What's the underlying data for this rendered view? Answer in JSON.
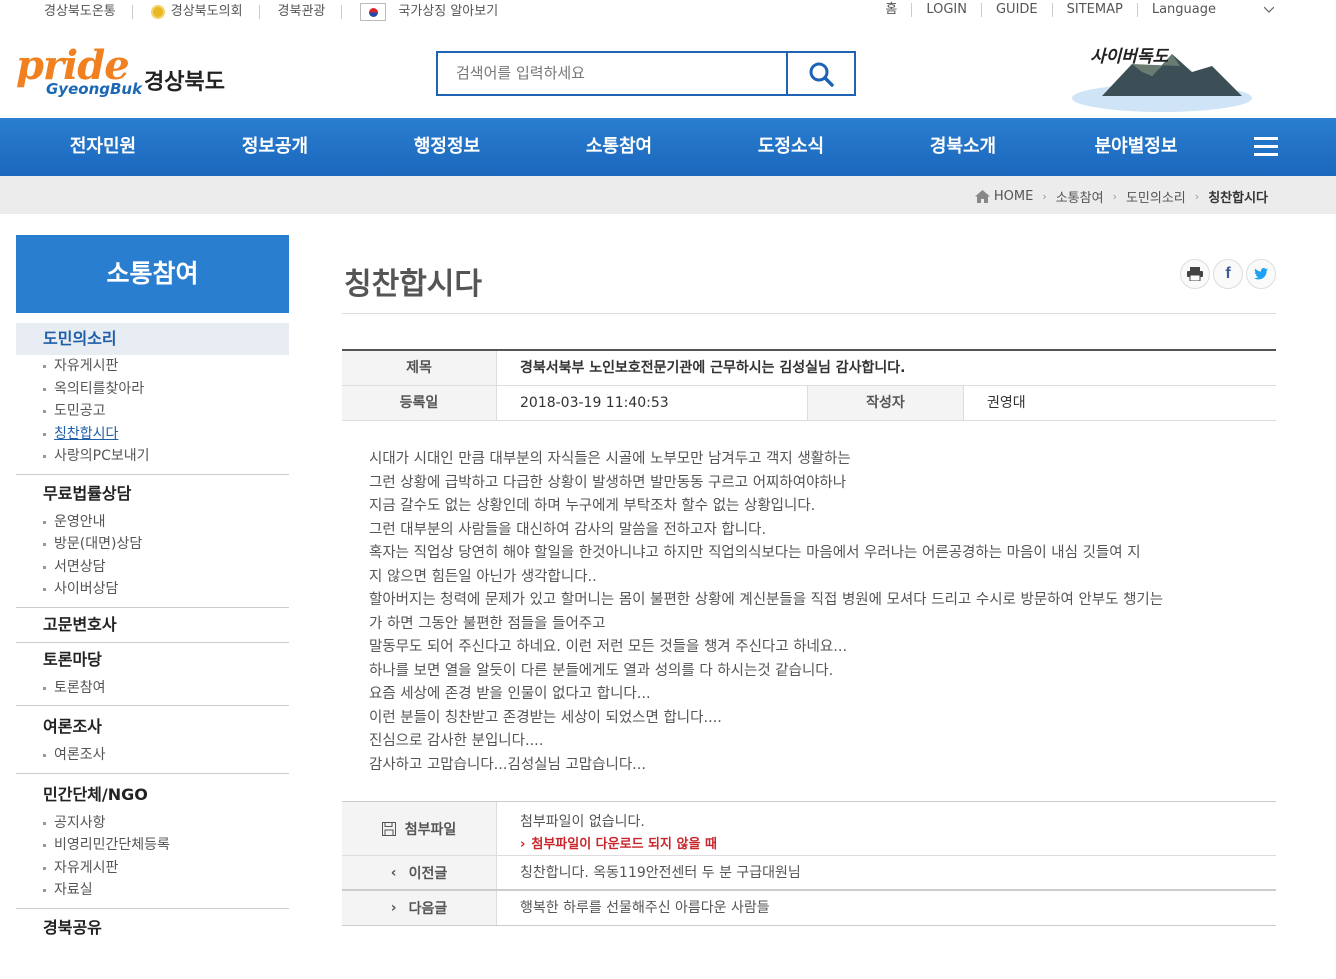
{
  "topbar": {
    "links": [
      "경상북도온통",
      "경상북도의회",
      "경북관광",
      "국가상징 알아보기"
    ],
    "right_links": [
      "홈",
      "LOGIN",
      "GUIDE",
      "SITEMAP",
      "Language"
    ]
  },
  "header": {
    "logo_main": "pride",
    "logo_sub": "GyeongBuk",
    "logo_name": "경상북도",
    "search_placeholder": "검색어를 입력하세요",
    "dokdo_label": "사이버독도"
  },
  "nav": {
    "items": [
      "전자민원",
      "정보공개",
      "행정정보",
      "소통참여",
      "도정소식",
      "경북소개",
      "분야별정보"
    ]
  },
  "breadcrumb": [
    "HOME",
    "소통참여",
    "도민의소리",
    "칭찬합시다"
  ],
  "sidebar": {
    "title": "소통참여",
    "groups": [
      {
        "head": "도민의소리",
        "items": [
          "자유게시판",
          "옥의티를찾아라",
          "도민공고",
          "칭찬합시다",
          "사랑의PC보내기"
        ]
      },
      {
        "head": "무료법률상담",
        "items": [
          "운영안내",
          "방문(대면)상담",
          "서면상담",
          "사이버상담"
        ]
      },
      {
        "head": "고문변호사",
        "items": []
      },
      {
        "head": "토론마당",
        "items": [
          "토론참여"
        ]
      },
      {
        "head": "여론조사",
        "items": [
          "여론조사"
        ]
      },
      {
        "head": "민간단체/NGO",
        "items": [
          "공지사항",
          "비영리민간단체등록",
          "자유게시판",
          "자료실"
        ]
      },
      {
        "head": "경북공유",
        "items": []
      }
    ]
  },
  "post": {
    "page_title": "칭찬합시다",
    "label_title": "제목",
    "title": "경북서북부 노인보호전문기관에 근무하시는 김성실님 감사합니다.",
    "label_date": "등록일",
    "date": "2018-03-19 11:40:53",
    "label_author": "작성자",
    "author": "권영대",
    "body": [
      "시대가 시대인 만큼 대부분의 자식들은 시골에 노부모만 남겨두고 객지 생활하는",
      "그런 상황에 급박하고 다급한 상황이 발생하면 발만동동 구르고 어찌하여야하나",
      "지금 갈수도 없는 상황인데 하며 누구에게 부탁조차 할수 없는 상황입니다.",
      "그런 대부분의 사람들을 대신하여 감사의 말씀을 전하고자 합니다.",
      "혹자는 직업상 당연히 해야 할일을 한것아니냐고 하지만 직업의식보다는 마음에서 우러나는 어른공경하는 마음이 내심 깃들여 지",
      "지 않으면 힘든일 아닌가 생각합니다..",
      "할아버지는 청력에 문제가 있고 할머니는 몸이 불편한 상황에 계신분들을 직접 병원에 모셔다 드리고 수시로 방문하여 안부도 챙기는",
      "가 하면 그동안 불편한 점들을 들어주고",
      "말동무도 되어 주신다고 하네요. 이런 저런 모든 것들을 챙겨 주신다고 하네요...",
      "하나를 보면 열을 알듯이 다른 분들에게도 열과 성의를 다 하시는것 같습니다.",
      "요즘 세상에 존경 받을 인물이 없다고 합니다...",
      "이런 분들이 칭찬받고 존경받는 세상이 되었스면 합니다....",
      "진심으로 감사한 분입니다....",
      "감사하고 고맙습니다...김성실님 고맙습니다..."
    ],
    "attach_label": "첨부파일",
    "attach_none": "첨부파일이 없습니다.",
    "attach_warn": "첨부파일이 다운로드 되지 않을 때",
    "prev_label": "이전글",
    "prev_title": "칭찬합니다. 옥동119안전센터 두 분 구급대원님",
    "next_label": "다음글",
    "next_title": "행복한 하루를 선물해주신 아름다운 사람들"
  },
  "colors": {
    "brand_blue": "#2a7ed0",
    "orange": "#f08020",
    "warn_red": "#c8262c"
  }
}
